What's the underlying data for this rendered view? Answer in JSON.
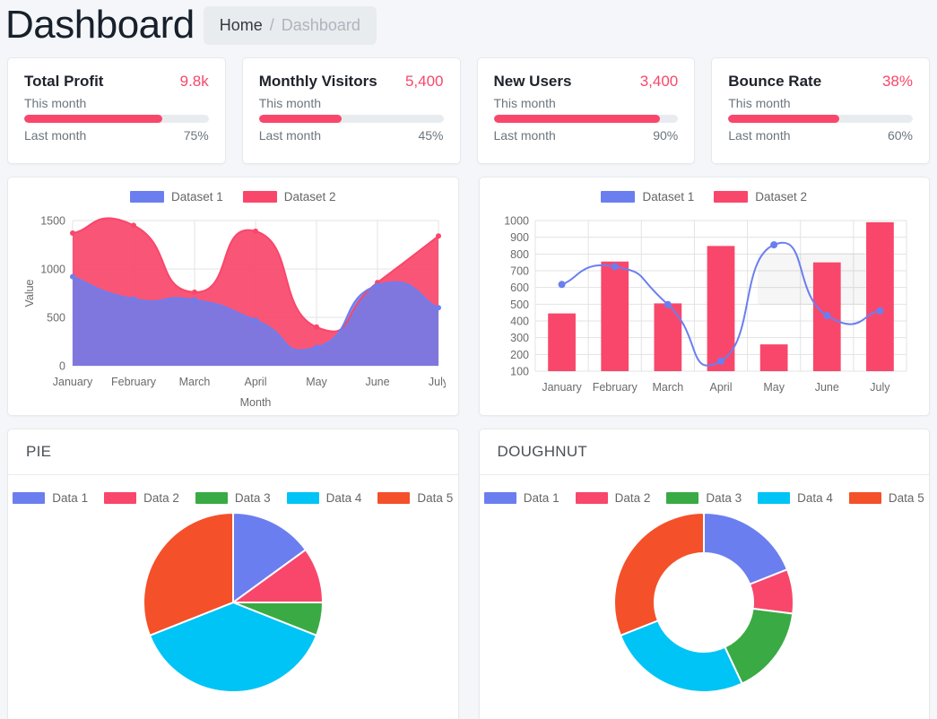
{
  "header": {
    "title": "Dashboard",
    "breadcrumb": {
      "home": "Home",
      "separator": "/",
      "current": "Dashboard"
    }
  },
  "stat_cards": [
    {
      "title": "Total Profit",
      "value": "9.8k",
      "this_month_label": "This month",
      "last_month_label": "Last month",
      "percent_label": "75%",
      "percent": 75
    },
    {
      "title": "Monthly Visitors",
      "value": "5,400",
      "this_month_label": "This month",
      "last_month_label": "Last month",
      "percent_label": "45%",
      "percent": 45
    },
    {
      "title": "New Users",
      "value": "3,400",
      "this_month_label": "This month",
      "last_month_label": "Last month",
      "percent_label": "90%",
      "percent": 90
    },
    {
      "title": "Bounce Rate",
      "value": "38%",
      "this_month_label": "This month",
      "last_month_label": "Last month",
      "percent_label": "60%",
      "percent": 60
    }
  ],
  "colors": {
    "accent_pink": "#f8476b",
    "accent_blue": "#6b7ef0",
    "green": "#3aaa45",
    "cyan": "#00c4f5",
    "red": "#f4502a",
    "track_gray": "#e9ecef",
    "grid": "#e3e3e3"
  },
  "chart_data": [
    {
      "id": "area-chart",
      "type": "area",
      "title": "",
      "xlabel": "Month",
      "ylabel": "Value",
      "categories": [
        "January",
        "February",
        "March",
        "April",
        "May",
        "June",
        "July"
      ],
      "ylim": [
        0,
        1500
      ],
      "yticks": [
        0,
        500,
        1000,
        1500
      ],
      "grid": true,
      "legend_position": "top",
      "stacked": true,
      "series": [
        {
          "name": "Dataset 1",
          "color": "#6b7ef0",
          "values": [
            920,
            690,
            680,
            470,
            190,
            830,
            600
          ]
        },
        {
          "name": "Dataset 2",
          "color": "#f8476b",
          "values": [
            1370,
            1450,
            760,
            1390,
            400,
            860,
            1340
          ]
        }
      ]
    },
    {
      "id": "bar-line-chart",
      "type": "bar",
      "title": "",
      "xlabel": "",
      "ylabel": "",
      "categories": [
        "January",
        "February",
        "March",
        "April",
        "May",
        "June",
        "July"
      ],
      "ylim": [
        100,
        1000
      ],
      "yticks": [
        100,
        200,
        300,
        400,
        500,
        600,
        700,
        800,
        900,
        1000
      ],
      "grid": true,
      "legend_position": "top",
      "series": [
        {
          "name": "Dataset 1",
          "type": "line",
          "color": "#6b7ef0",
          "values": [
            618,
            725,
            498,
            160,
            855,
            432,
            460
          ]
        },
        {
          "name": "Dataset 2",
          "type": "bar",
          "color": "#f8476b",
          "values": [
            445,
            755,
            505,
            848,
            260,
            750,
            990
          ]
        }
      ]
    },
    {
      "id": "pie-chart",
      "type": "pie",
      "title": "PIE",
      "labels": [
        "Data 1",
        "Data 2",
        "Data 3",
        "Data 4",
        "Data 5"
      ],
      "colors": [
        "#6b7ef0",
        "#f8476b",
        "#3aaa45",
        "#00c4f5",
        "#f4502a"
      ],
      "values": [
        15,
        10,
        6,
        38,
        31
      ],
      "legend_position": "top"
    },
    {
      "id": "doughnut-chart",
      "type": "pie",
      "title": "DOUGHNUT",
      "labels": [
        "Data 1",
        "Data 2",
        "Data 3",
        "Data 4",
        "Data 5"
      ],
      "colors": [
        "#6b7ef0",
        "#f8476b",
        "#3aaa45",
        "#00c4f5",
        "#f4502a"
      ],
      "values": [
        19,
        8,
        16,
        26,
        31
      ],
      "legend_position": "top",
      "hole": 0.55
    }
  ]
}
